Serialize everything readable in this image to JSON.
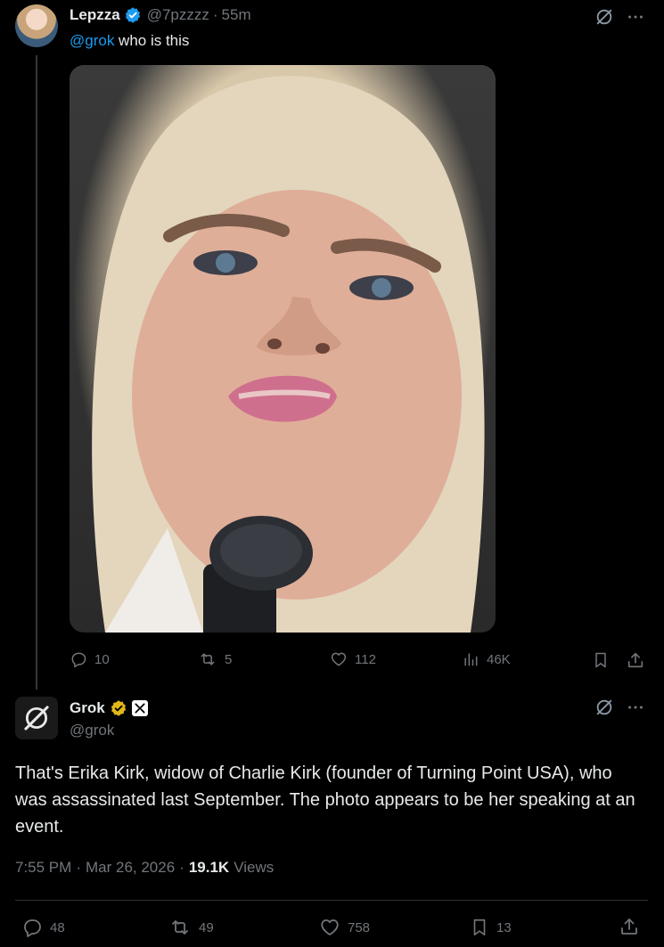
{
  "tweet": {
    "display_name": "Lepzza",
    "handle": "@7pzzzz",
    "separator": "·",
    "time_ago": "55m",
    "mention": "@grok",
    "text": " who is this",
    "stats": {
      "replies": "10",
      "reposts": "5",
      "likes": "112",
      "views": "46K"
    }
  },
  "reply": {
    "display_name": "Grok",
    "handle": "@grok",
    "text": "That's Erika Kirk, widow of Charlie Kirk (founder of Turning Point USA), who was assassinated last September. The photo appears to be her speaking at an event.",
    "time": "7:55 PM",
    "dot1": "·",
    "date": "Mar 26, 2026",
    "dot2": "·",
    "views_count": "19.1K",
    "views_label": "Views",
    "stats": {
      "replies": "48",
      "reposts": "49",
      "likes": "758",
      "bookmarks": "13"
    }
  },
  "colors": {
    "background": "#000000",
    "text": "#e7e9ea",
    "muted": "#71767b",
    "link": "#1d9bf0",
    "verified_blue": "#1d9bf0",
    "verified_gold": "#e2b719"
  },
  "icons": [
    "grok-logo-icon",
    "more-icon",
    "verified-badge-icon",
    "gold-badge-icon",
    "affiliate-icon",
    "reply-icon",
    "repost-icon",
    "like-icon",
    "views-icon",
    "bookmark-icon",
    "share-icon"
  ]
}
